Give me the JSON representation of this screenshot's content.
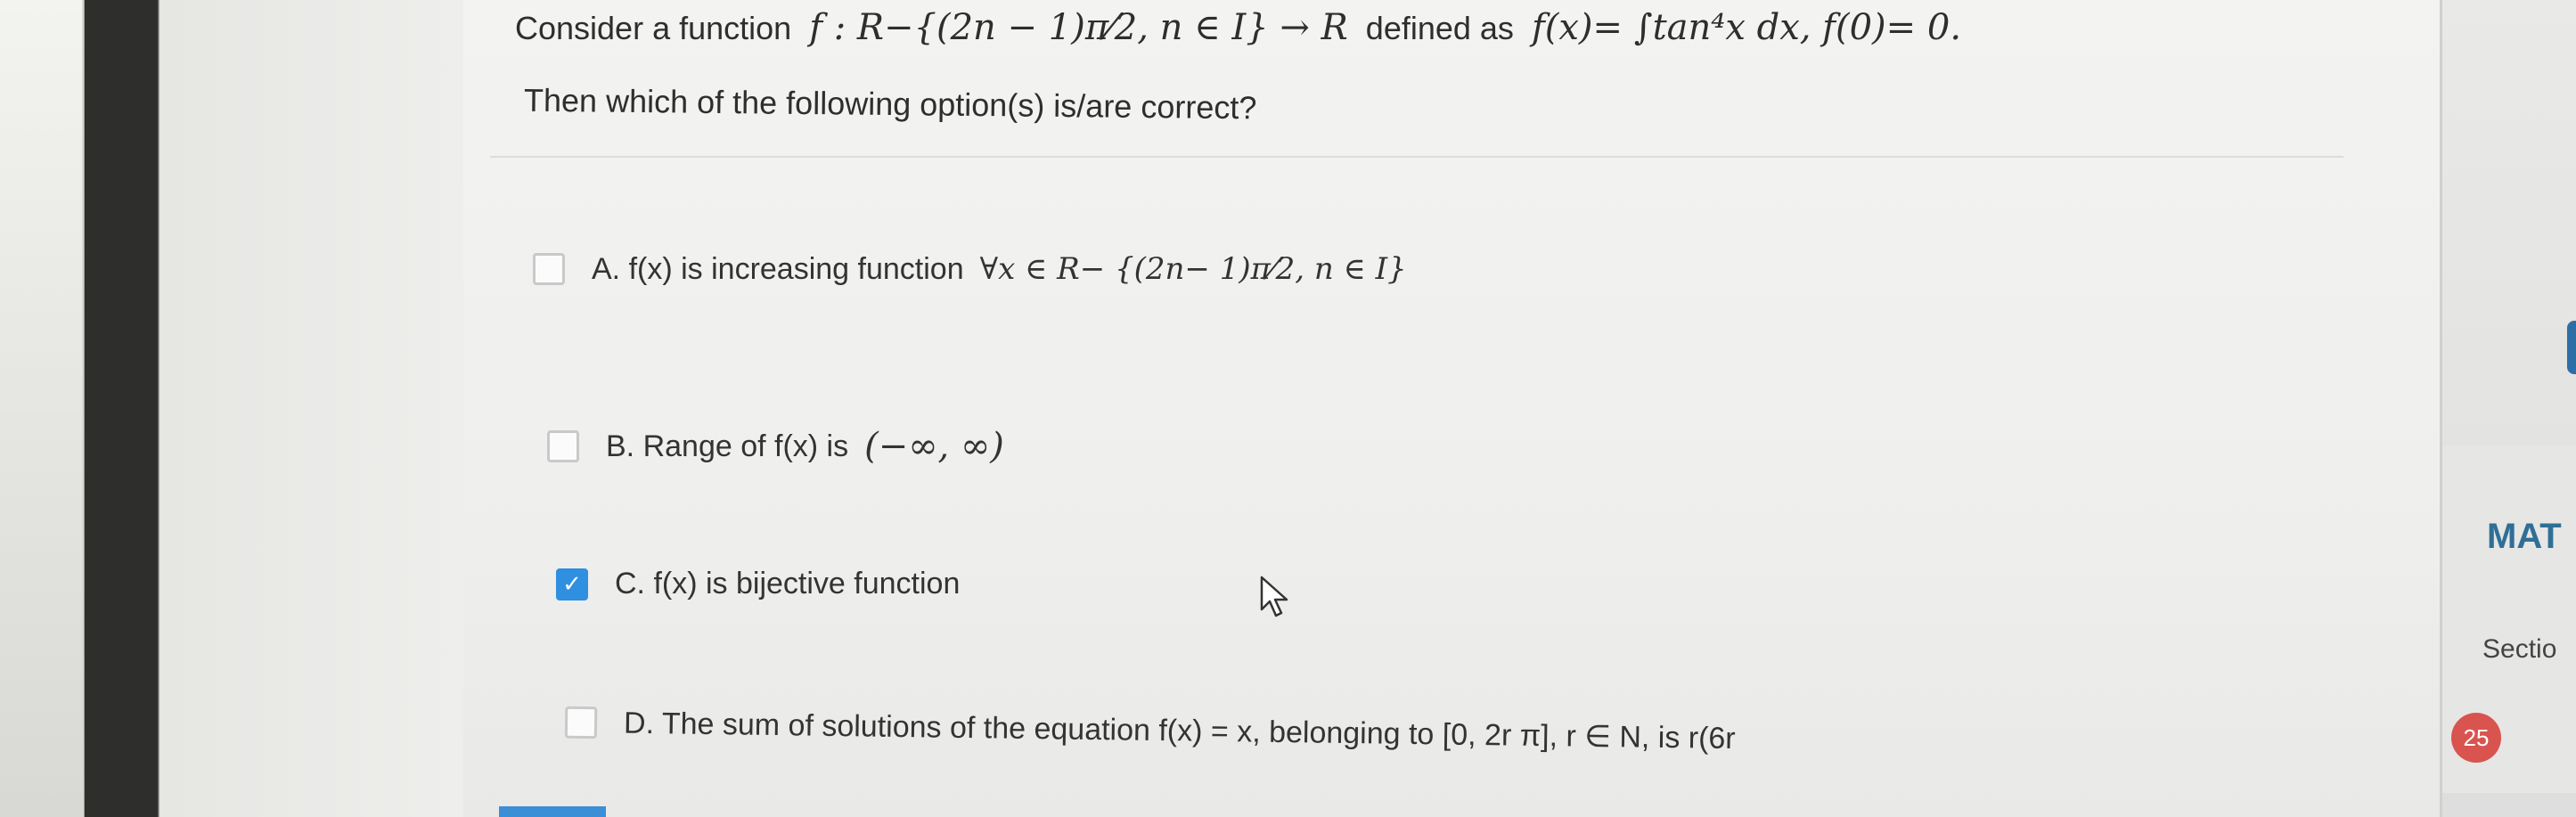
{
  "question": {
    "line1_prefix": "Consider a function",
    "line1_math": "f : R−{(2n − 1)π⁄2, n ∈ I} → R",
    "line1_mid": "defined as",
    "line1_math2": "f(x)= ∫tan⁴x dx,  f(0)= 0.",
    "line2": "Then which of the following option(s) is/are correct?"
  },
  "options": [
    {
      "text": "A. f(x) is increasing function",
      "math": "∀x ∈ R− {(2n− 1)π⁄2, n ∈ I}",
      "checked": false
    },
    {
      "text": "B. Range of f(x) is",
      "math": "(−∞, ∞)",
      "checked": false
    },
    {
      "text": "C. f(x) is bijective function",
      "math": "",
      "checked": true
    },
    {
      "text": "D. The sum of solutions of the equation f(x) = x, belonging to [0, 2r π], r ∈ N, is r(6r",
      "math": "",
      "checked": false
    }
  ],
  "side_panel": {
    "subject_label": "MAT",
    "section_label": "Sectio",
    "question_count": "25"
  },
  "icons": {
    "check": "✓",
    "cursor": "mouse-pointer-icon"
  },
  "colors": {
    "checkbox_checked": "#2f8fe0",
    "badge": "#d9534f",
    "subject": "#2f6f97"
  }
}
